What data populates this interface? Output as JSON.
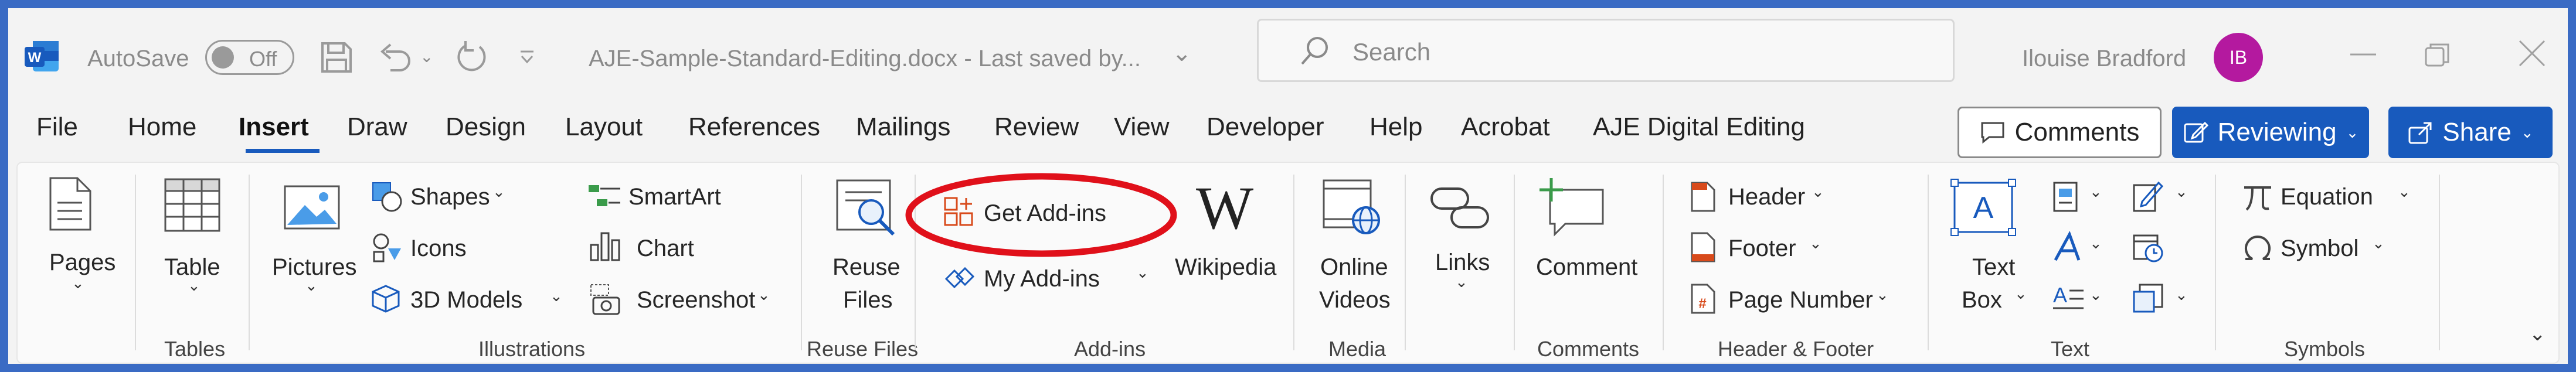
{
  "titlebar": {
    "app_icon": "word-icon",
    "autosave_label": "AutoSave",
    "autosave_state": "Off",
    "document_title": "AJE-Sample-Standard-Editing.docx  -  Last saved by...",
    "search_placeholder": "Search",
    "user_name": "Ilouise Bradford",
    "user_initials": "IB"
  },
  "menu": {
    "tabs": [
      "File",
      "Home",
      "Insert",
      "Draw",
      "Design",
      "Layout",
      "References",
      "Mailings",
      "Review",
      "View",
      "Developer",
      "Help",
      "Acrobat",
      "AJE Digital Editing"
    ],
    "active_tab": "Insert",
    "comments_button": "Comments",
    "reviewing_button": "Reviewing",
    "share_button": "Share"
  },
  "ribbon": {
    "pages": "Pages",
    "table": "Table",
    "pictures": "Pictures",
    "shapes": "Shapes",
    "icons": "Icons",
    "models3d": "3D Models",
    "smartart": "SmartArt",
    "chart": "Chart",
    "screenshot": "Screenshot",
    "reuse_files_line1": "Reuse",
    "reuse_files_line2": "Files",
    "get_addins": "Get Add-ins",
    "my_addins": "My Add-ins",
    "wikipedia": "Wikipedia",
    "wikipedia_glyph": "W",
    "online_videos_line1": "Online",
    "online_videos_line2": "Videos",
    "links": "Links",
    "comment": "Comment",
    "header": "Header",
    "footer": "Footer",
    "page_number": "Page Number",
    "text_box_line1": "Text",
    "text_box_line2": "Box",
    "equation": "Equation",
    "symbol": "Symbol",
    "groups": {
      "tables": "Tables",
      "illustrations": "Illustrations",
      "reuse_files": "Reuse Files",
      "addins": "Add-ins",
      "media": "Media",
      "comments": "Comments",
      "header_footer": "Header & Footer",
      "text": "Text",
      "symbols": "Symbols"
    }
  },
  "colors": {
    "frame": "#3a6bc4",
    "accent": "#185abd",
    "annotation_circle": "#e0101a",
    "avatar": "#b4199f"
  }
}
